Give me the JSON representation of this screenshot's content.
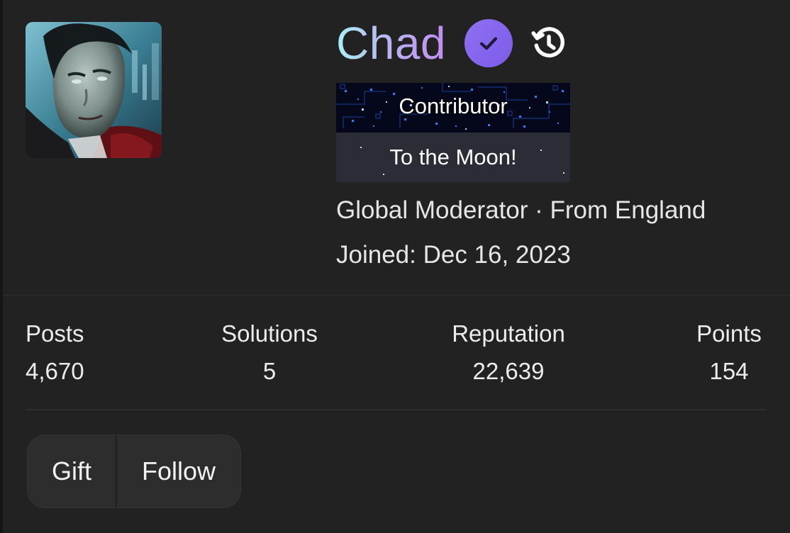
{
  "profile": {
    "username": "Chad",
    "avatar_alt": "avatar",
    "badges": [
      "Contributor",
      "To the Moon!"
    ],
    "role_line": "Global Moderator · From England",
    "joined_line": "Joined: Dec 16, 2023"
  },
  "stats": [
    {
      "label": "Posts",
      "value": "4,670"
    },
    {
      "label": "Solutions",
      "value": "5"
    },
    {
      "label": "Reputation",
      "value": "22,639"
    },
    {
      "label": "Points",
      "value": "154"
    }
  ],
  "actions": {
    "gift_label": "Gift",
    "follow_label": "Follow"
  },
  "icons": {
    "verified": "verified-check-icon",
    "history": "history-icon"
  },
  "colors": {
    "card_bg": "#222222",
    "page_bg": "#161616",
    "verified_badge": "#8a6cf0",
    "username_gradient_start": "#a9f0f6",
    "username_gradient_end": "#c28cf2"
  }
}
